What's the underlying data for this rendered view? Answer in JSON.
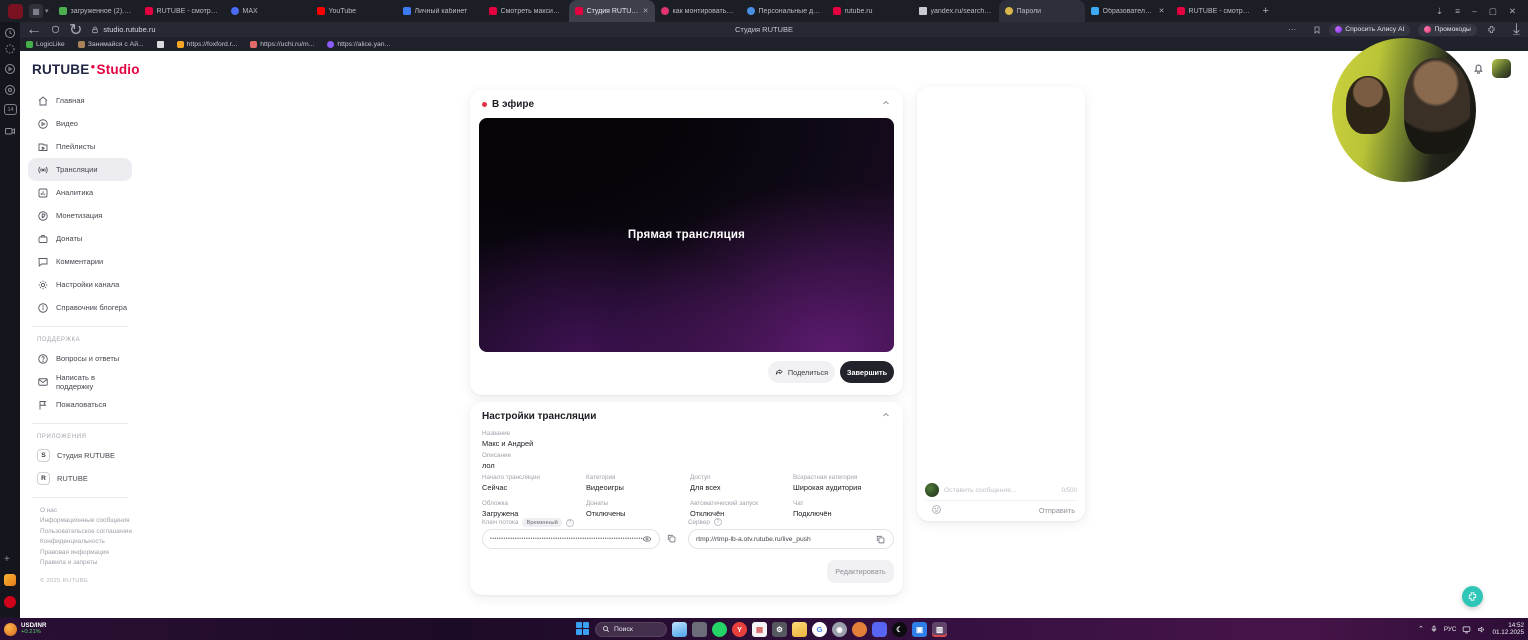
{
  "browser": {
    "tabs": [
      {
        "label": "загруженное (2).png"
      },
      {
        "label": "RUTUBE - смотреть вид..."
      },
      {
        "label": "MAX"
      },
      {
        "label": "YouTube"
      },
      {
        "label": "Личный кабинет"
      },
      {
        "label": "Смотреть максим на RU..."
      },
      {
        "label": "Студия RUTUBE",
        "active": true
      },
      {
        "label": "как монтировать фото в..."
      },
      {
        "label": "Персональные данные -..."
      },
      {
        "label": "rutube.ru"
      },
      {
        "label": "yandex.ru/search/?text=..."
      },
      {
        "label": "Пароли"
      },
      {
        "label": "Образовательный по..."
      },
      {
        "label": "RUTUBE - смотреть вид..."
      }
    ],
    "toolbar": {
      "url": "studio.rutube.ru",
      "page_title": "Студия RUTUBE",
      "alice_button": "Спросить Алису AI",
      "promo_button": "Промокоды"
    },
    "bookmarks": [
      "LogicLike",
      "Занимайся с Ай...",
      "https://foxford.r...",
      "https://uchi.ru/m...",
      "https://alice.yan..."
    ],
    "side_panel": {
      "messenger_badge": "14"
    }
  },
  "studio": {
    "logo_text": "RUTUBE",
    "logo_accent": "Studio",
    "nav": [
      {
        "label": "Главная"
      },
      {
        "label": "Видео"
      },
      {
        "label": "Плейлисты"
      },
      {
        "label": "Трансляции",
        "selected": true
      },
      {
        "label": "Аналитика"
      },
      {
        "label": "Монетизация"
      },
      {
        "label": "Донаты"
      },
      {
        "label": "Комментарии"
      },
      {
        "label": "Настройки канала"
      },
      {
        "label": "Справочник блогера"
      }
    ],
    "support_section": "ПОДДЕРЖКА",
    "support": [
      {
        "label": "Вопросы и ответы"
      },
      {
        "label": "Написать в поддержку"
      },
      {
        "label": "Пожаловаться"
      }
    ],
    "apps_section": "ПРИЛОЖЕНИЯ",
    "apps": [
      {
        "label": "Студия RUTUBE",
        "icon_letter": "S"
      },
      {
        "label": "RUTUBE",
        "icon_letter": "R"
      }
    ],
    "footer_links": [
      "О нас",
      "Информационные сообщения",
      "Пользовательское соглашение",
      "Конфиденциальность",
      "Правовая информация",
      "Правила и запреты"
    ],
    "copyright": "© 2025 RUTUBE"
  },
  "live": {
    "header": "В эфире",
    "player_text": "Прямая трансляция",
    "share_button": "Поделиться",
    "finish_button": "Завершить"
  },
  "settings": {
    "header": "Настройки трансляции",
    "name_label": "Название",
    "name_value": "Макс и Андрей",
    "description_label": "Описание",
    "description_value": "лол",
    "grid": [
      {
        "label": "Начало трансляции",
        "value": "Сейчас"
      },
      {
        "label": "Категория",
        "value": "Видеоигры"
      },
      {
        "label": "Доступ",
        "value": "Для всех"
      },
      {
        "label": "Возрастная категория",
        "value": "Широкая аудитория"
      },
      {
        "label": "Обложка",
        "value": "Загружена"
      },
      {
        "label": "Донаты",
        "value": "Отключены"
      },
      {
        "label": "Автоматический запуск",
        "value": "Отключён"
      },
      {
        "label": "Чат",
        "value": "Подключён"
      }
    ],
    "stream_key_label": "Ключ потока",
    "stream_key_badge": "Временный",
    "stream_key_masked": "••••••••••••••••••••••••••••••••••••••••••••••••••••••••••••••••••••••••",
    "server_label": "Сервер",
    "server_value": "rtmp://rtmp-lb-a.otv.rutube.ru/live_push",
    "edit_button": "Редактировать"
  },
  "chat": {
    "placeholder": "Оставить сообщение...",
    "counter": "0/500",
    "send_button": "Отправить"
  },
  "taskbar": {
    "widget_pair": "USD/INR",
    "widget_change": "+0.21%",
    "search_placeholder": "Поиск",
    "language": "РУС",
    "time": "14:52",
    "date": "01.12.2025"
  },
  "colors": {
    "rutube_red": "#e4003f",
    "live_dot": "#e23047",
    "finish_button_bg": "#22232a",
    "selected_nav_bg": "#ededf1",
    "widget_green": "#57d66b",
    "fab_teal": "#2fc6b7"
  }
}
